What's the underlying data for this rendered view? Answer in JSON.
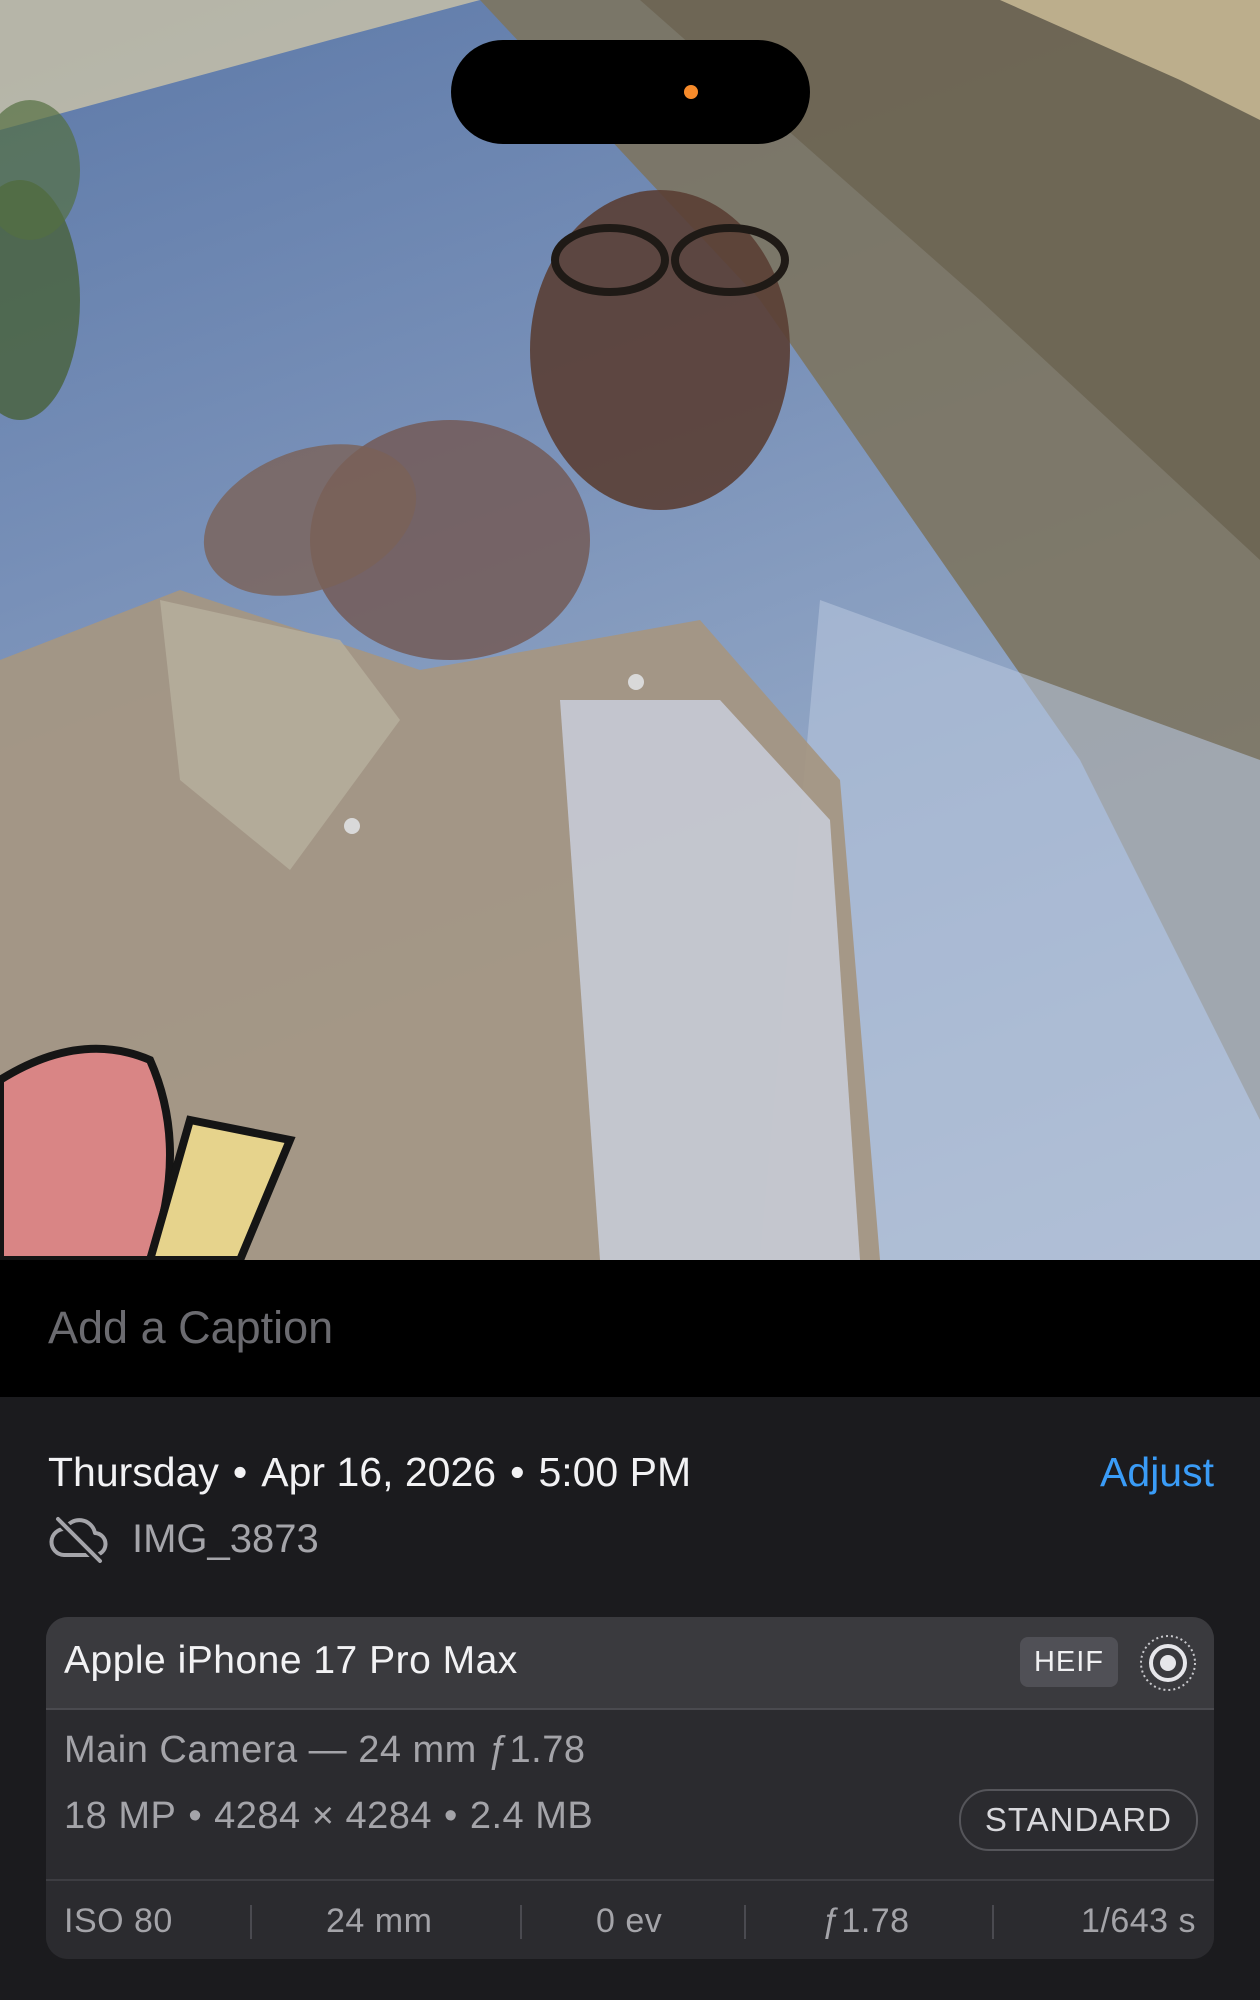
{
  "photo": {
    "description_icon": "photo-image"
  },
  "caption": {
    "placeholder": "Add a Caption",
    "value": ""
  },
  "info": {
    "day": "Thursday",
    "date": "Apr 16, 2026",
    "time": "5:00 PM",
    "separator": "•",
    "adjust_label": "Adjust",
    "filename": "IMG_3873",
    "cloud_icon": "icloud-slash-icon"
  },
  "exif": {
    "device": "Apple iPhone 17 Pro Max",
    "format": "HEIF",
    "live_icon": "live-photo-icon",
    "camera": "Main Camera — 24 mm ƒ1.78",
    "megapixels": "18 MP",
    "resolution": "4284 × 4284",
    "size": "2.4 MB",
    "separator": "•",
    "mode": "STANDARD",
    "iso": "ISO 80",
    "focal_length": "24 mm",
    "exposure_value": "0 ev",
    "aperture": "ƒ1.78",
    "shutter": "1/643 s"
  },
  "colors": {
    "accent": "#3a9cf7",
    "privacy_indicator": "#f78b2b",
    "sheet_background": "#1b1b1e",
    "card_background": "#2b2b2f"
  }
}
